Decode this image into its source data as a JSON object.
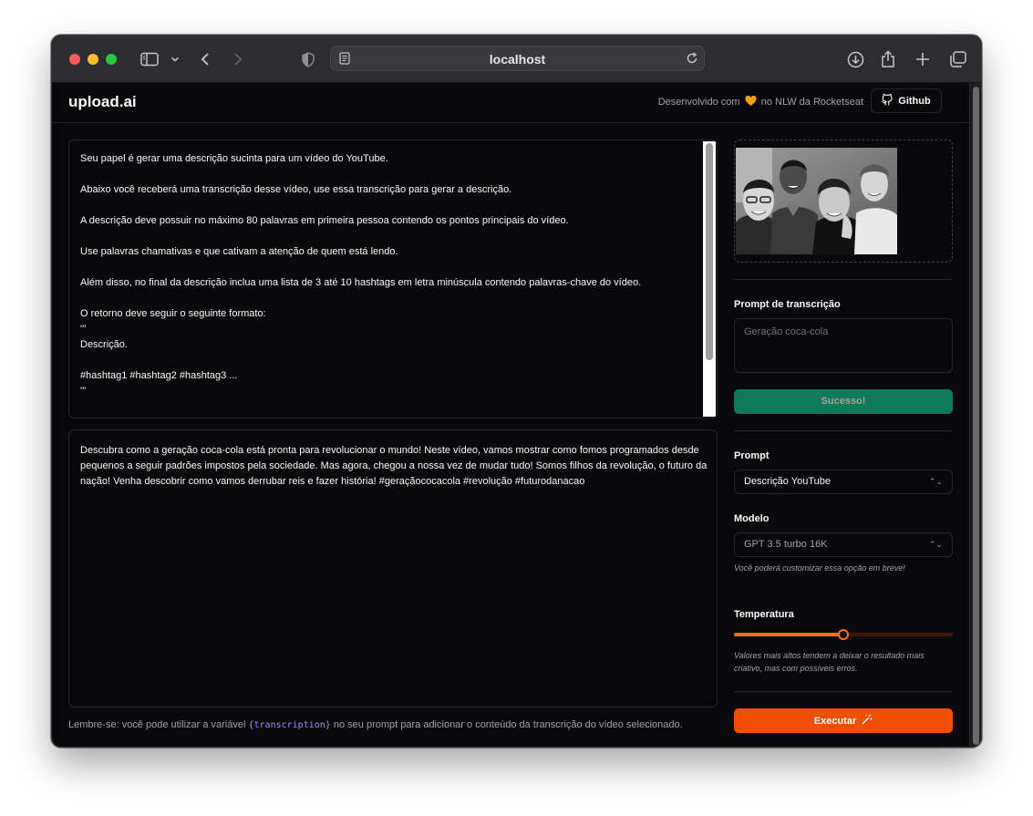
{
  "browser": {
    "url": "localhost"
  },
  "header": {
    "logo": "upload.ai",
    "credits_prefix": "Desenvolvido com",
    "credits_suffix": "no NLW da Rocketseat",
    "github_label": "Github"
  },
  "editor": {
    "prompt_text": "Seu papel é gerar uma descrição sucinta para um vídeo do YouTube.\n\nAbaixo você receberá uma transcrição desse vídeo, use essa transcrição para gerar a descrição.\n\nA descrição deve possuir no máximo 80 palavras em primeira pessoa contendo os pontos principais do vídeo.\n\nUse palavras chamativas e que cativam a atenção de quem está lendo.\n\nAlém disso, no final da descrição inclua uma lista de 3 até 10 hashtags em letra minúscula contendo palavras-chave do vídeo.\n\nO retorno deve seguir o seguinte formato:\n'''\nDescrição.\n\n#hashtag1 #hashtag2 #hashtag3 ...\n'''",
    "result_text": "Descubra como a geração coca-cola está pronta para revolucionar o mundo! Neste vídeo, vamos mostrar como fomos programados desde pequenos a seguir padrões impostos pela sociedade. Mas agora, chegou a nossa vez de mudar tudo! Somos filhos da revolução, o futuro da nação! Venha descobrir como vamos derrubar reis e fazer história! #geraçãococacola #revolução #futurodanacao",
    "hint_before": "Lembre-se: você pode utilizar a variável",
    "hint_variable": "{transcription}",
    "hint_after": "no seu prompt para adicionar o conteúdo da transcrição do vídeo selecionado."
  },
  "sidebar": {
    "transcription_label": "Prompt de transcrição",
    "transcription_value": "Geração coca-cola",
    "upload_button": "Sucesso!",
    "prompt_label": "Prompt",
    "prompt_selected": "Descrição YouTube",
    "model_label": "Modelo",
    "model_selected": "GPT 3.5 turbo 16K",
    "model_note": "Você poderá customizar essa opção em breve!",
    "temperature_label": "Temperatura",
    "temperature_value": 0.5,
    "temperature_note": "Valores mais altos tendem a deixar o resultado mais criativo, mas com possíveis erros.",
    "run_button": "Executar"
  },
  "colors": {
    "accent": "#f04d05",
    "success": "#0f7a58",
    "background": "#09090b",
    "border": "#27272a",
    "variable": "#a78bfa"
  },
  "icons": {
    "sidebar": "sidebar-icon",
    "back": "chevron-left-icon",
    "forward": "chevron-right-icon",
    "shield": "shield-icon",
    "reader": "reader-icon",
    "reload": "reload-icon",
    "download": "download-icon",
    "share": "share-icon",
    "new_tab": "plus-icon",
    "tabs": "tabs-icon",
    "heart": "heart-icon",
    "github": "github-icon",
    "wand": "wand-icon"
  }
}
